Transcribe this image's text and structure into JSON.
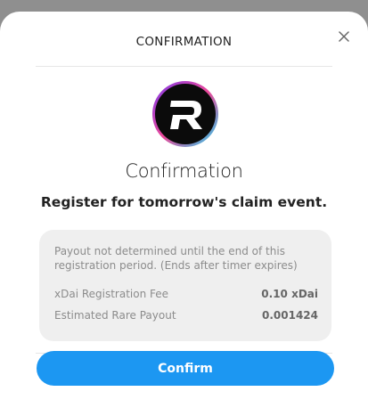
{
  "header": {
    "title": "CONFIRMATION",
    "close_icon": "close-icon"
  },
  "logo": {
    "icon": "rare-logo-icon",
    "letter": "R",
    "ring_colors": [
      "#7c3aed",
      "#ec4899",
      "#22d3ee"
    ]
  },
  "main": {
    "title": "Confirmation",
    "subtitle": "Register for tomorrow's claim event."
  },
  "info": {
    "note": "Payout not determined until the end of this registration period. (Ends after timer expires)",
    "rows": [
      {
        "label": "xDai Registration Fee",
        "value": "0.10 xDai"
      },
      {
        "label": "Estimated Rare Payout",
        "value": "0.001424"
      }
    ]
  },
  "actions": {
    "confirm_label": "Confirm"
  },
  "colors": {
    "accent": "#1c97f2",
    "backdrop": "#8f8f8f"
  }
}
